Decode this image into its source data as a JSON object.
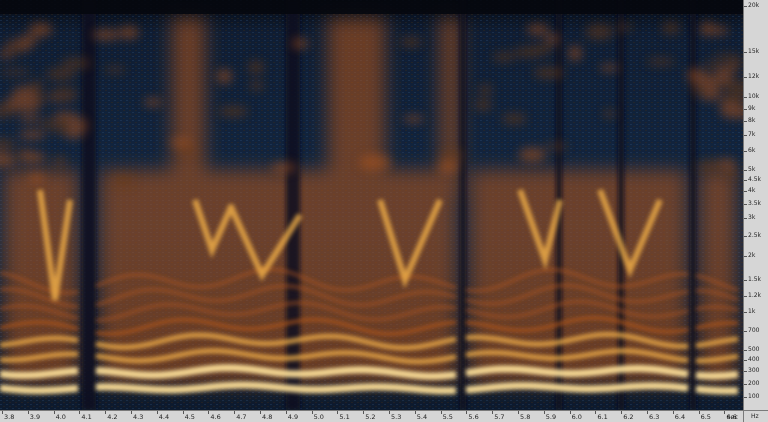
{
  "view": {
    "type": "spectrogram",
    "frequency_unit": "Hz",
    "time_unit": "sec",
    "colors": {
      "background": "#0b111c",
      "low_energy": "#10233f",
      "mid_energy": "#b1561b",
      "high_energy": "#f6b34a",
      "peak": "#ffe19a",
      "axis_background": "#d6d6d6"
    }
  },
  "freq_axis": {
    "labels": [
      {
        "text": "20k",
        "value": 20000
      },
      {
        "text": "15k",
        "value": 15000
      },
      {
        "text": "12k",
        "value": 12000
      },
      {
        "text": "10k",
        "value": 10000
      },
      {
        "text": "9k",
        "value": 9000
      },
      {
        "text": "8k",
        "value": 8000
      },
      {
        "text": "7k",
        "value": 7000
      },
      {
        "text": "6k",
        "value": 6000
      },
      {
        "text": "5k",
        "value": 5000
      },
      {
        "text": "4.5k",
        "value": 4500
      },
      {
        "text": "4k",
        "value": 4000
      },
      {
        "text": "3.5k",
        "value": 3500
      },
      {
        "text": "3k",
        "value": 3000
      },
      {
        "text": "2.5k",
        "value": 2500
      },
      {
        "text": "2k",
        "value": 2000
      },
      {
        "text": "1.5k",
        "value": 1500
      },
      {
        "text": "1.2k",
        "value": 1200
      },
      {
        "text": "1k",
        "value": 1000
      },
      {
        "text": "700",
        "value": 700
      },
      {
        "text": "500",
        "value": 500
      },
      {
        "text": "400",
        "value": 400
      },
      {
        "text": "300",
        "value": 300
      },
      {
        "text": "200",
        "value": 200
      },
      {
        "text": "100",
        "value": 100
      }
    ],
    "unit_label": "Hz"
  },
  "time_axis": {
    "labels": [
      "3.8",
      "3.9",
      "4.0",
      "4.1",
      "4.2",
      "4.3",
      "4.4",
      "4.5",
      "4.6",
      "4.7",
      "4.8",
      "4.9",
      "5.0",
      "5.1",
      "5.2",
      "5.3",
      "5.4",
      "5.5",
      "5.6",
      "5.7",
      "5.8",
      "5.9",
      "6.0",
      "6.1",
      "6.2",
      "6.3",
      "6.4",
      "6.5",
      "6.6"
    ],
    "unit_label": "sec"
  }
}
